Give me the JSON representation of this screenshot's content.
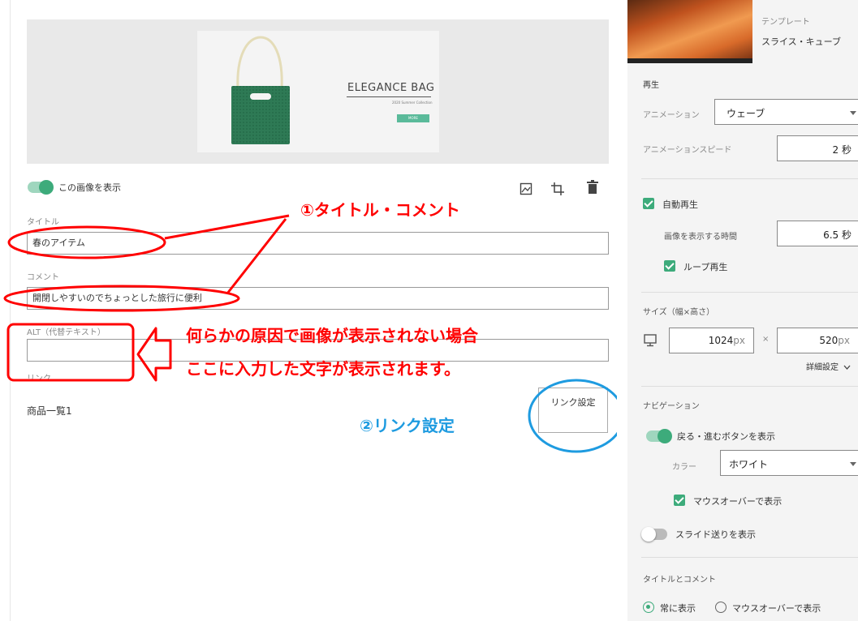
{
  "slide": {
    "brand": "ELEGANCE BAG",
    "subtitle": "2020 Summer Collection",
    "button": "MORE"
  },
  "editor": {
    "show_image_label": "この画像を表示",
    "title_label": "タイトル",
    "title_value": "春のアイテム",
    "comment_label": "コメント",
    "comment_value": "開閉しやすいのでちょっとした旅行に便利",
    "alt_label": "ALT（代替テキスト）",
    "alt_value": "",
    "link_label": "リンク",
    "link_value": "商品一覧1",
    "link_button": "リンク設定"
  },
  "annotations": {
    "title_comment": "①タイトル・コメント",
    "alt_line1": "何らかの原因で画像が表示されない場合",
    "alt_line2": "ここに入力した文字が表示されます。",
    "link": "②リンク設定"
  },
  "settings": {
    "template_label": "テンプレート",
    "template_name": "スライス・キューブ",
    "playback_heading": "再生",
    "animation_label": "アニメーション",
    "animation_value": "ウェーブ",
    "speed_label": "アニメーションスピード",
    "speed_value": "2",
    "speed_unit": "秒",
    "autoplay_label": "自動再生",
    "display_time_label": "画像を表示する時間",
    "display_time_value": "6.5",
    "display_time_unit": "秒",
    "loop_label": "ループ再生",
    "size_heading": "サイズ（幅×高さ）",
    "width_value": "1024",
    "height_value": "520",
    "unit_px": "px",
    "times": "×",
    "advanced_label": "詳細設定",
    "nav_heading": "ナビゲーション",
    "nav_buttons_label": "戻る・進むボタンを表示",
    "color_label": "カラー",
    "color_value": "ホワイト",
    "mouseover_label": "マウスオーバーで表示",
    "slide_feed_label": "スライド送りを表示",
    "title_comment_heading": "タイトルとコメント",
    "always_label": "常に表示",
    "mouseover_option_label": "マウスオーバーで表示"
  },
  "colors": {
    "accent": "#3dab7b",
    "annotation_red": "#ff0000",
    "annotation_blue": "#1e9be0"
  }
}
